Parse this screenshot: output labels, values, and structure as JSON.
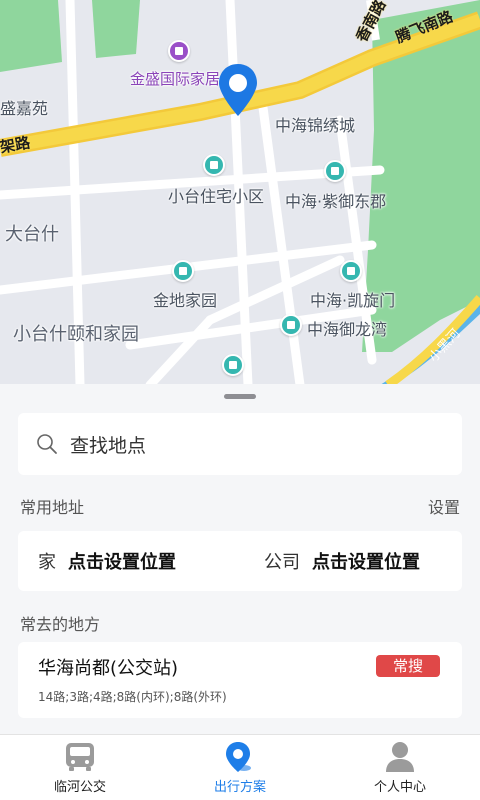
{
  "map": {
    "labels": {
      "jinsheng": "金盛国际家居",
      "shengjiayuan": "盛嘉苑",
      "jialu": "架路",
      "xunanlu": "香南路",
      "tengfeinanlu": "腾飞南路",
      "zhonghaijinxiucheng": "中海锦绣城",
      "xiaotaizhuzhai": "小台住宅小区",
      "zhonghaiziyudongjun": "中海·紫御东郡",
      "datai": "大台什",
      "jindijiayuan": "金地家园",
      "zhonghaikaixuanmen": "中海·凯旋门",
      "xiaotaiyihe": "小台什颐和家园",
      "zhonghaiyulongwan": "中海御龙湾",
      "xiaoheihe": "小黑河"
    }
  },
  "search": {
    "placeholder": "查找地点"
  },
  "common": {
    "title": "常用地址",
    "settings": "设置",
    "home_label": "家",
    "home_value": "点击设置位置",
    "company_label": "公司",
    "company_value": "点击设置位置"
  },
  "frequent": {
    "title": "常去的地方",
    "items": [
      {
        "name": "华海尚都(公交站)",
        "routes": "14路;3路;4路;8路(内环);8路(外环)",
        "badge": "常搜"
      }
    ]
  },
  "tabs": [
    {
      "label": "临河公交",
      "icon": "bus-icon"
    },
    {
      "label": "出行方案",
      "icon": "map-pin-icon"
    },
    {
      "label": "个人中心",
      "icon": "person-icon"
    }
  ],
  "colors": {
    "accent": "#1e7ee8",
    "badge": "#e04848",
    "park_green": "#8fd69d",
    "main_road": "#f7d84a",
    "poi_teal": "#35b7b0"
  }
}
